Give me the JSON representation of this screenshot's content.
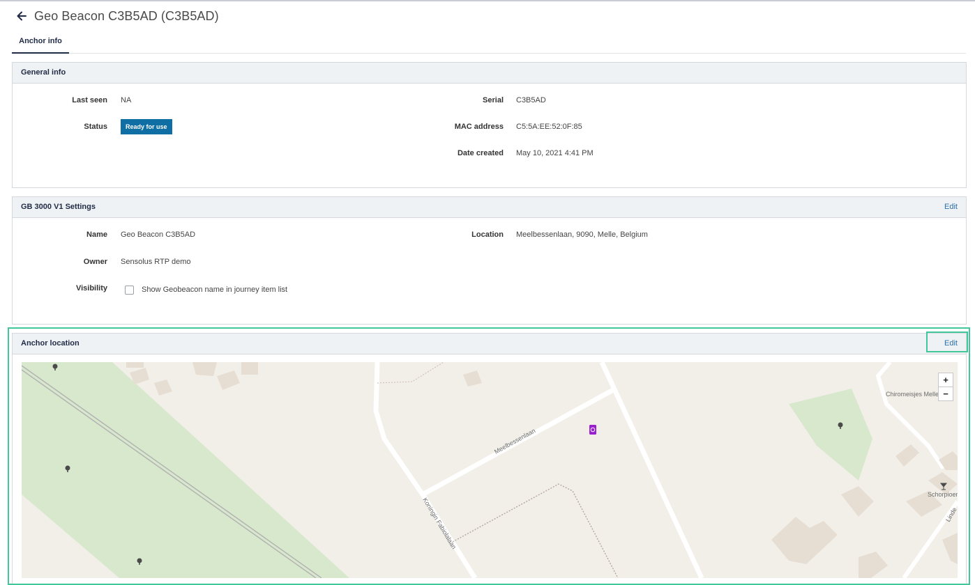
{
  "header": {
    "title": "Geo Beacon C3B5AD (C3B5AD)"
  },
  "tabs": [
    {
      "label": "Anchor info",
      "active": true
    }
  ],
  "general_info": {
    "title": "General info",
    "last_seen_label": "Last seen",
    "last_seen": "NA",
    "status_label": "Status",
    "status": "Ready for use",
    "serial_label": "Serial",
    "serial": "C3B5AD",
    "mac_label": "MAC address",
    "mac": "C5:5A:EE:52:0F:85",
    "date_created_label": "Date created",
    "date_created": "May 10, 2021 4:41 PM"
  },
  "settings": {
    "title": "GB 3000 V1 Settings",
    "edit_label": "Edit",
    "name_label": "Name",
    "name": "Geo Beacon C3B5AD",
    "owner_label": "Owner",
    "owner": "Sensolus RTP demo",
    "visibility_label": "Visibility",
    "visibility_checkbox_label": "Show Geobeacon name in journey item list",
    "visibility_checked": false,
    "location_label": "Location",
    "location": "Meelbessenlaan, 9090, Melle, Belgium"
  },
  "anchor_location": {
    "title": "Anchor location",
    "edit_label": "Edit",
    "zoom_in": "+",
    "zoom_out": "−",
    "map_labels": {
      "street1": "Meelbessenlaan",
      "street2": "Koningin Fabiolalaan",
      "poi1": "Chiromeisjes Melle",
      "poi2": "Schorpioen",
      "street3": "Linde"
    },
    "colors": {
      "park": "#d8e8cc",
      "road": "#ffffff",
      "building": "#e6ddd3",
      "marker": "#9b1fcf"
    }
  },
  "icons": {
    "back": "arrow-left-icon",
    "marker": "geobeacon-marker-icon",
    "tree": "tree-icon"
  },
  "colors": {
    "accent": "#0f6ea3",
    "link": "#2a6fa8",
    "highlight": "#42c79a"
  }
}
